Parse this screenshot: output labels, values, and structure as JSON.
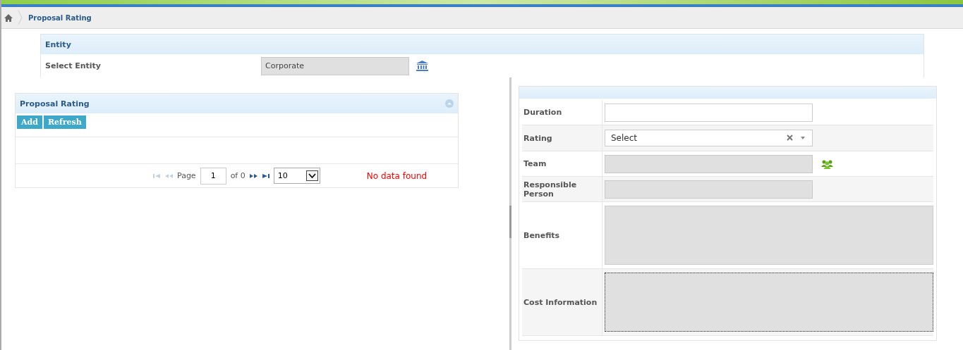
{
  "breadcrumb": {
    "current": "Proposal Rating"
  },
  "entity_panel": {
    "title": "Entity",
    "label": "Select Entity",
    "value": "Corporate"
  },
  "grid_panel": {
    "title": "Proposal Rating",
    "buttons": [
      "Add",
      "Refresh"
    ],
    "pager": {
      "page_label": "Page",
      "page": "1",
      "of": "of 0",
      "page_size": "10",
      "first_disabled": true,
      "prev_disabled": true,
      "next_disabled": false,
      "last_disabled": false
    },
    "message": "No data found"
  },
  "form": {
    "rows": [
      {
        "label": "Duration",
        "kind": "text"
      },
      {
        "label": "Rating",
        "kind": "select",
        "placeholder": "Select"
      },
      {
        "label": "Team",
        "kind": "readonly",
        "picker": true
      },
      {
        "label": "Responsible Person",
        "kind": "readonly",
        "picker": false
      },
      {
        "label": "Benefits",
        "kind": "textarea",
        "focused": false
      },
      {
        "label": "Cost Information",
        "kind": "textarea",
        "focused": true
      }
    ]
  }
}
